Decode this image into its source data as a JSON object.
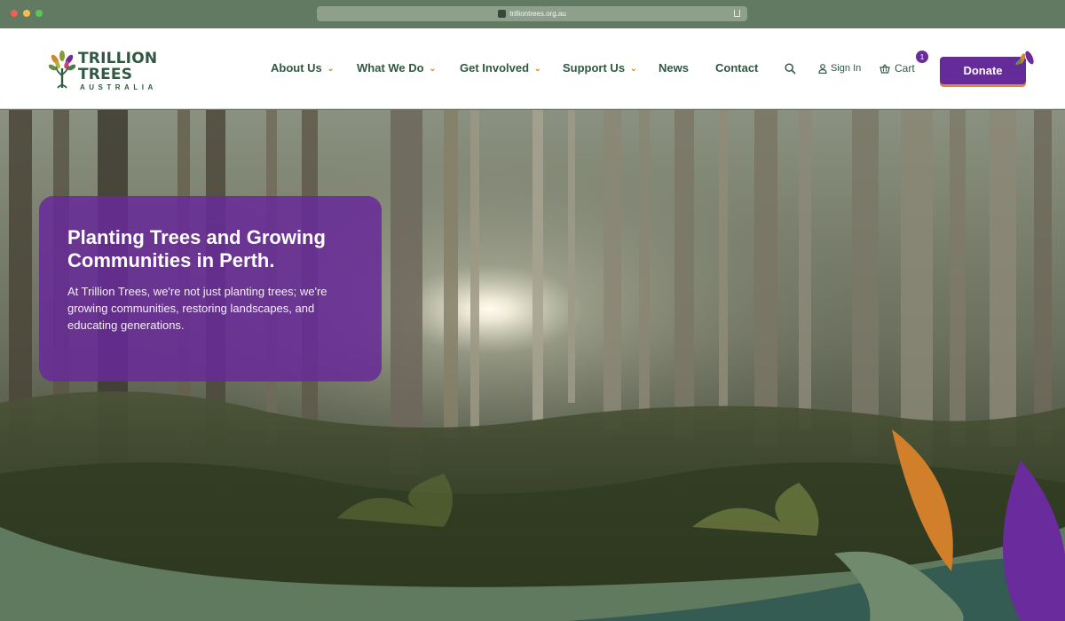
{
  "browser": {
    "url": "trilliontrees.org.au"
  },
  "logo": {
    "line1": "TRILLION",
    "line2": "TREES",
    "line3": "AUSTRALIA"
  },
  "nav": {
    "items": [
      {
        "label": "About Us",
        "has_dropdown": true
      },
      {
        "label": "What We Do",
        "has_dropdown": true
      },
      {
        "label": "Get Involved",
        "has_dropdown": true
      },
      {
        "label": "Support Us",
        "has_dropdown": true
      },
      {
        "label": "News",
        "has_dropdown": false
      },
      {
        "label": "Contact",
        "has_dropdown": false
      }
    ],
    "dropdown_glyph": "⌄",
    "sign_in": "Sign In",
    "cart": "Cart",
    "cart_count": "1",
    "donate": "Donate"
  },
  "hero": {
    "title": "Planting Trees and Growing Communities in Perth.",
    "text": "At Trillion Trees, we're not just planting trees; we're growing communities, restoring landscapes, and educating generations."
  },
  "icons": {
    "search": "search-icon",
    "user": "user-icon",
    "cart": "basket-icon",
    "dropdown": "chevron-down-icon"
  },
  "colors": {
    "brand_green": "#315843",
    "brand_purple": "#652b99",
    "accent_orange": "#d3862a",
    "chrome": "#637a62"
  }
}
